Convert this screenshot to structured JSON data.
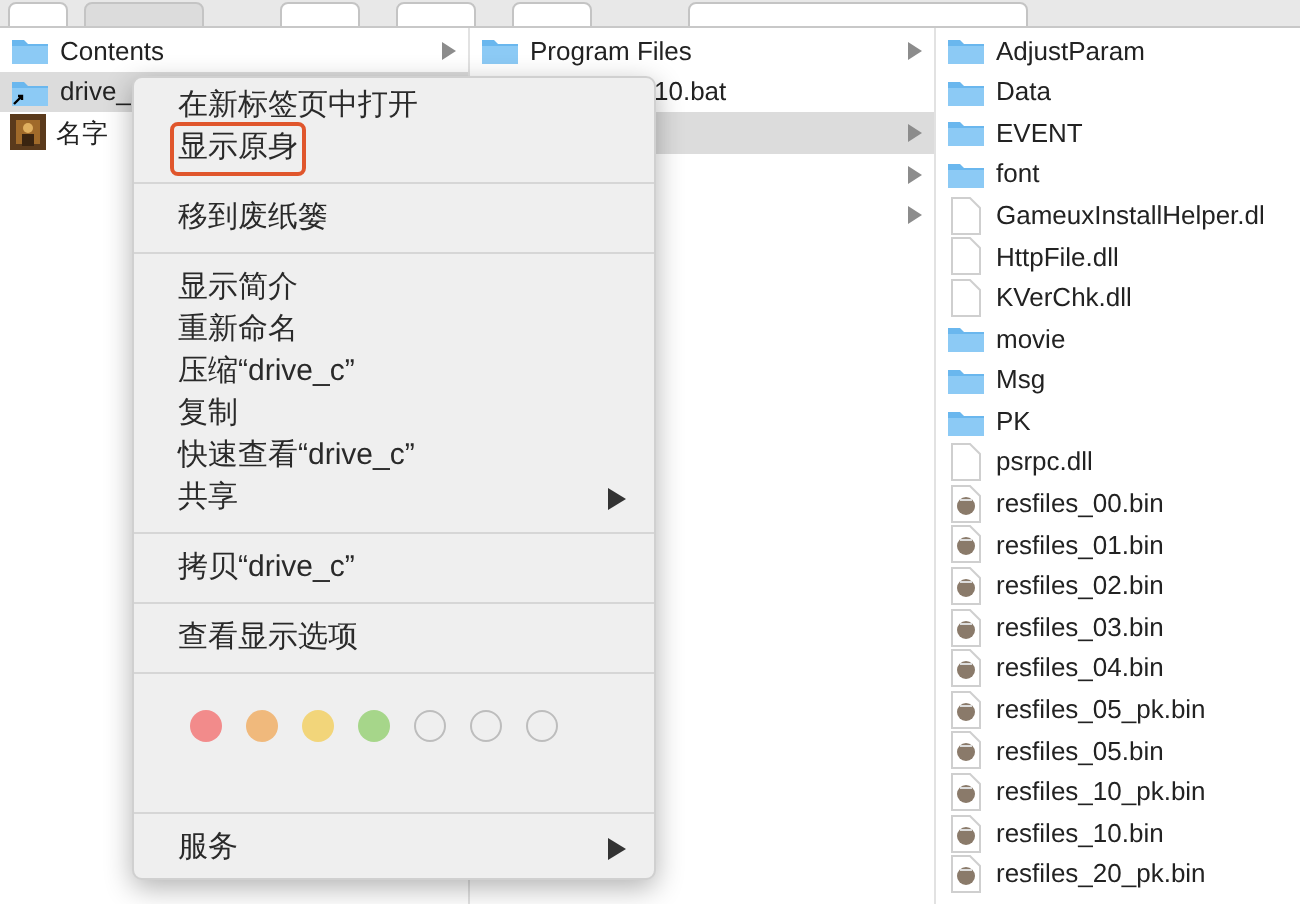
{
  "columns": [
    {
      "rows": [
        {
          "name": "Contents",
          "kind": "folder",
          "arrow": true,
          "selected": false
        },
        {
          "name": "drive_",
          "kind": "alias",
          "arrow": false,
          "selected": true
        },
        {
          "name": "名字",
          "arrow": false,
          "selected": false
        }
      ]
    },
    {
      "rows": [
        {
          "name": "Program Files",
          "kind": "folder",
          "arrow": true,
          "selected": false
        },
        {
          "name": "10.bat",
          "kind": "covered",
          "arrow": false,
          "selected": false
        },
        {
          "kind": "blank",
          "arrow": true,
          "selected": true
        },
        {
          "kind": "blank",
          "arrow": true,
          "selected": false
        },
        {
          "kind": "blank",
          "arrow": true,
          "selected": false
        }
      ]
    },
    {
      "rows": [
        {
          "name": "AdjustParam",
          "kind": "folder",
          "arrow": false,
          "selected": false
        },
        {
          "name": "Data",
          "kind": "folder",
          "arrow": false,
          "selected": false
        },
        {
          "name": "EVENT",
          "kind": "folder",
          "arrow": false,
          "selected": false
        },
        {
          "name": "font",
          "kind": "folder",
          "arrow": false,
          "selected": false
        },
        {
          "name": "GameuxInstallHelper.dl",
          "kind": "doc",
          "arrow": false,
          "selected": false
        },
        {
          "name": "HttpFile.dll",
          "kind": "doc",
          "arrow": false,
          "selected": false
        },
        {
          "name": "KVerChk.dll",
          "kind": "doc",
          "arrow": false,
          "selected": false
        },
        {
          "name": "movie",
          "kind": "folder",
          "arrow": false,
          "selected": false
        },
        {
          "name": "Msg",
          "kind": "folder",
          "arrow": false,
          "selected": false
        },
        {
          "name": "PK",
          "kind": "folder",
          "arrow": false,
          "selected": false
        },
        {
          "name": "psrpc.dll",
          "kind": "doc",
          "arrow": false,
          "selected": false
        },
        {
          "name": "resfiles_00.bin",
          "kind": "bin",
          "arrow": false,
          "selected": false
        },
        {
          "name": "resfiles_01.bin",
          "kind": "bin",
          "arrow": false,
          "selected": false
        },
        {
          "name": "resfiles_02.bin",
          "kind": "bin",
          "arrow": false,
          "selected": false
        },
        {
          "name": "resfiles_03.bin",
          "kind": "bin",
          "arrow": false,
          "selected": false
        },
        {
          "name": "resfiles_04.bin",
          "kind": "bin",
          "arrow": false,
          "selected": false
        },
        {
          "name": "resfiles_05_pk.bin",
          "kind": "bin",
          "arrow": false,
          "selected": false
        },
        {
          "name": "resfiles_05.bin",
          "kind": "bin",
          "arrow": false,
          "selected": false
        },
        {
          "name": "resfiles_10_pk.bin",
          "kind": "bin",
          "arrow": false,
          "selected": false
        },
        {
          "name": "resfiles_10.bin",
          "kind": "bin",
          "arrow": false,
          "selected": false
        },
        {
          "name": "resfiles_20_pk.bin",
          "kind": "bin",
          "arrow": false,
          "selected": false
        }
      ]
    }
  ],
  "context_menu": {
    "sections": [
      {
        "kind": "items",
        "items": [
          {
            "label": "在新标签页中打开",
            "submenu": false,
            "highlighted": false
          },
          {
            "label": "显示原身",
            "submenu": false,
            "highlighted": true
          }
        ]
      },
      {
        "kind": "items",
        "items": [
          {
            "label": "移到废纸篓",
            "submenu": false,
            "highlighted": false
          }
        ]
      },
      {
        "kind": "items",
        "items": [
          {
            "label": "显示简介",
            "submenu": false,
            "highlighted": false
          },
          {
            "label": "重新命名",
            "submenu": false,
            "highlighted": false
          },
          {
            "label": "压缩“drive_c”",
            "submenu": false,
            "highlighted": false
          },
          {
            "label": "复制",
            "submenu": false,
            "highlighted": false
          },
          {
            "label": "快速查看“drive_c”",
            "submenu": false,
            "highlighted": false
          },
          {
            "label": "共享",
            "submenu": true,
            "highlighted": false
          }
        ]
      },
      {
        "kind": "items",
        "items": [
          {
            "label": "拷贝“drive_c”",
            "submenu": false,
            "highlighted": false
          }
        ]
      },
      {
        "kind": "items",
        "items": [
          {
            "label": "查看显示选项",
            "submenu": false,
            "highlighted": false
          }
        ]
      },
      {
        "kind": "tags",
        "tags": [
          {
            "kind": "filled",
            "color": "#f28b8b"
          },
          {
            "kind": "filled",
            "color": "#f0b97c"
          },
          {
            "kind": "filled",
            "color": "#f2d57a"
          },
          {
            "kind": "filled",
            "color": "#a6d68a"
          },
          {
            "kind": "empty"
          },
          {
            "kind": "empty"
          },
          {
            "kind": "empty"
          }
        ]
      },
      {
        "kind": "items",
        "items": [
          {
            "label": "服务",
            "submenu": true,
            "highlighted": false
          }
        ]
      }
    ]
  }
}
